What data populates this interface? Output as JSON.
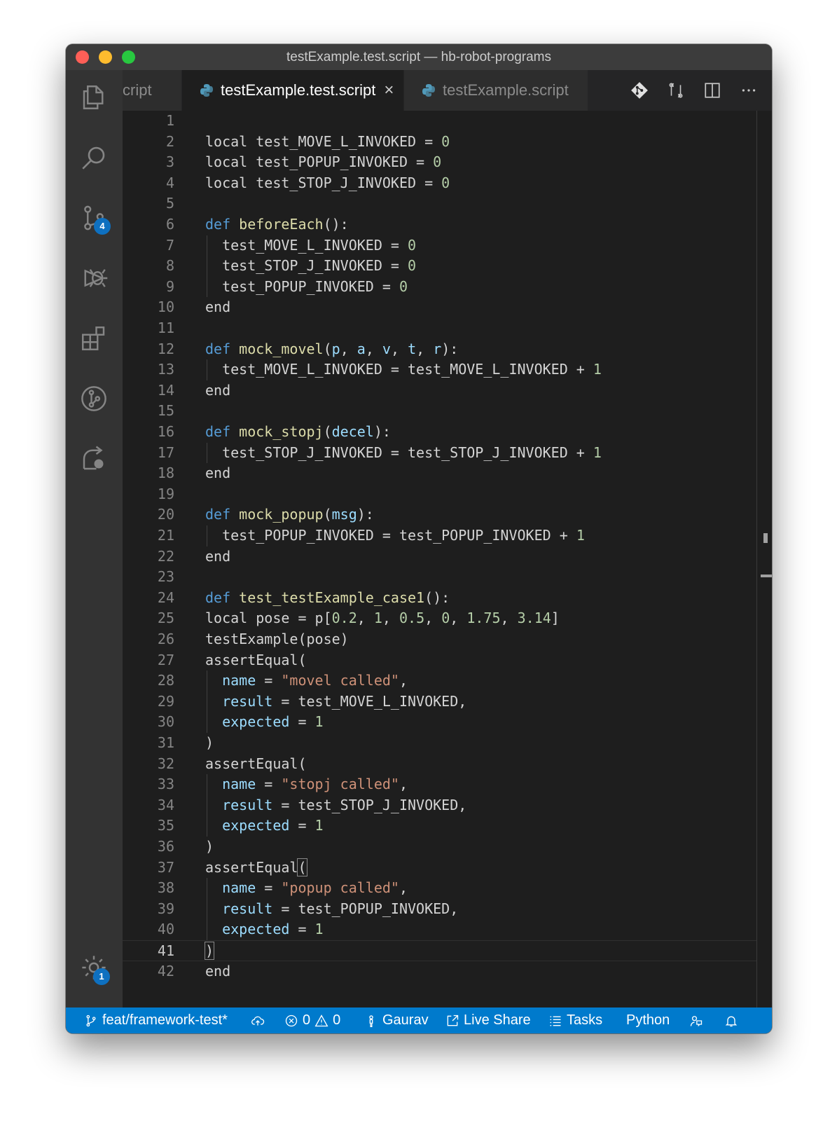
{
  "window": {
    "title": "testExample.test.script — hb-robot-programs"
  },
  "activity_bar": {
    "scm_badge": "4",
    "settings_badge": "1"
  },
  "tabs": [
    {
      "label": "testExample.vars.script",
      "visible_label": "cript",
      "active": false
    },
    {
      "label": "testExample.test.script",
      "active": true,
      "close": "×"
    },
    {
      "label": "testExample.script",
      "active": false
    }
  ],
  "editor": {
    "current_line": 41,
    "lines": [
      {
        "n": "1",
        "indent": 0,
        "tokens": []
      },
      {
        "n": "2",
        "indent": 0,
        "tokens": [
          {
            "t": "local test_MOVE_L_INVOKED = "
          },
          {
            "t": "0",
            "c": "num"
          }
        ]
      },
      {
        "n": "3",
        "indent": 0,
        "tokens": [
          {
            "t": "local test_POPUP_INVOKED = "
          },
          {
            "t": "0",
            "c": "num"
          }
        ]
      },
      {
        "n": "4",
        "indent": 0,
        "tokens": [
          {
            "t": "local test_STOP_J_INVOKED = "
          },
          {
            "t": "0",
            "c": "num"
          }
        ]
      },
      {
        "n": "5",
        "indent": 0,
        "tokens": []
      },
      {
        "n": "6",
        "indent": 0,
        "tokens": [
          {
            "t": "def",
            "c": "kw"
          },
          {
            "t": " "
          },
          {
            "t": "beforeEach",
            "c": "fn"
          },
          {
            "t": "():"
          }
        ]
      },
      {
        "n": "7",
        "indent": 1,
        "tokens": [
          {
            "t": "test_MOVE_L_INVOKED = "
          },
          {
            "t": "0",
            "c": "num"
          }
        ]
      },
      {
        "n": "8",
        "indent": 1,
        "tokens": [
          {
            "t": "test_STOP_J_INVOKED = "
          },
          {
            "t": "0",
            "c": "num"
          }
        ]
      },
      {
        "n": "9",
        "indent": 1,
        "tokens": [
          {
            "t": "test_POPUP_INVOKED = "
          },
          {
            "t": "0",
            "c": "num"
          }
        ]
      },
      {
        "n": "10",
        "indent": 0,
        "tokens": [
          {
            "t": "end"
          }
        ]
      },
      {
        "n": "11",
        "indent": 0,
        "tokens": []
      },
      {
        "n": "12",
        "indent": 0,
        "tokens": [
          {
            "t": "def",
            "c": "kw"
          },
          {
            "t": " "
          },
          {
            "t": "mock_movel",
            "c": "fn"
          },
          {
            "t": "("
          },
          {
            "t": "p",
            "c": "var"
          },
          {
            "t": ", "
          },
          {
            "t": "a",
            "c": "var"
          },
          {
            "t": ", "
          },
          {
            "t": "v",
            "c": "var"
          },
          {
            "t": ", "
          },
          {
            "t": "t",
            "c": "var"
          },
          {
            "t": ", "
          },
          {
            "t": "r",
            "c": "var"
          },
          {
            "t": "):"
          }
        ]
      },
      {
        "n": "13",
        "indent": 1,
        "tokens": [
          {
            "t": "test_MOVE_L_INVOKED = test_MOVE_L_INVOKED + "
          },
          {
            "t": "1",
            "c": "num"
          }
        ]
      },
      {
        "n": "14",
        "indent": 0,
        "tokens": [
          {
            "t": "end"
          }
        ]
      },
      {
        "n": "15",
        "indent": 0,
        "tokens": []
      },
      {
        "n": "16",
        "indent": 0,
        "tokens": [
          {
            "t": "def",
            "c": "kw"
          },
          {
            "t": " "
          },
          {
            "t": "mock_stopj",
            "c": "fn"
          },
          {
            "t": "("
          },
          {
            "t": "decel",
            "c": "var"
          },
          {
            "t": "):"
          }
        ]
      },
      {
        "n": "17",
        "indent": 1,
        "tokens": [
          {
            "t": "test_STOP_J_INVOKED = test_STOP_J_INVOKED + "
          },
          {
            "t": "1",
            "c": "num"
          }
        ]
      },
      {
        "n": "18",
        "indent": 0,
        "tokens": [
          {
            "t": "end"
          }
        ]
      },
      {
        "n": "19",
        "indent": 0,
        "tokens": []
      },
      {
        "n": "20",
        "indent": 0,
        "tokens": [
          {
            "t": "def",
            "c": "kw"
          },
          {
            "t": " "
          },
          {
            "t": "mock_popup",
            "c": "fn"
          },
          {
            "t": "("
          },
          {
            "t": "msg",
            "c": "var"
          },
          {
            "t": "):"
          }
        ]
      },
      {
        "n": "21",
        "indent": 1,
        "tokens": [
          {
            "t": "test_POPUP_INVOKED = test_POPUP_INVOKED + "
          },
          {
            "t": "1",
            "c": "num"
          }
        ]
      },
      {
        "n": "22",
        "indent": 0,
        "tokens": [
          {
            "t": "end"
          }
        ]
      },
      {
        "n": "23",
        "indent": 0,
        "tokens": []
      },
      {
        "n": "24",
        "indent": 0,
        "tokens": [
          {
            "t": "def",
            "c": "kw"
          },
          {
            "t": " "
          },
          {
            "t": "test_testExample_case1",
            "c": "fn"
          },
          {
            "t": "():"
          }
        ]
      },
      {
        "n": "25",
        "indent": 0,
        "tokens": [
          {
            "t": "local pose = p["
          },
          {
            "t": "0.2",
            "c": "num"
          },
          {
            "t": ", "
          },
          {
            "t": "1",
            "c": "num"
          },
          {
            "t": ", "
          },
          {
            "t": "0.5",
            "c": "num"
          },
          {
            "t": ", "
          },
          {
            "t": "0",
            "c": "num"
          },
          {
            "t": ", "
          },
          {
            "t": "1.75",
            "c": "num"
          },
          {
            "t": ", "
          },
          {
            "t": "3.14",
            "c": "num"
          },
          {
            "t": "]"
          }
        ]
      },
      {
        "n": "26",
        "indent": 0,
        "tokens": [
          {
            "t": "testExample(pose)"
          }
        ]
      },
      {
        "n": "27",
        "indent": 0,
        "tokens": [
          {
            "t": "assertEqual("
          }
        ]
      },
      {
        "n": "28",
        "indent": 1,
        "tokens": [
          {
            "t": "name",
            "c": "var"
          },
          {
            "t": " = "
          },
          {
            "t": "\"movel called\"",
            "c": "str"
          },
          {
            "t": ","
          }
        ]
      },
      {
        "n": "29",
        "indent": 1,
        "tokens": [
          {
            "t": "result",
            "c": "var"
          },
          {
            "t": " = test_MOVE_L_INVOKED,"
          }
        ]
      },
      {
        "n": "30",
        "indent": 1,
        "tokens": [
          {
            "t": "expected",
            "c": "var"
          },
          {
            "t": " = "
          },
          {
            "t": "1",
            "c": "num"
          }
        ]
      },
      {
        "n": "31",
        "indent": 0,
        "tokens": [
          {
            "t": ")"
          }
        ]
      },
      {
        "n": "32",
        "indent": 0,
        "tokens": [
          {
            "t": "assertEqual("
          }
        ]
      },
      {
        "n": "33",
        "indent": 1,
        "tokens": [
          {
            "t": "name",
            "c": "var"
          },
          {
            "t": " = "
          },
          {
            "t": "\"stopj called\"",
            "c": "str"
          },
          {
            "t": ","
          }
        ]
      },
      {
        "n": "34",
        "indent": 1,
        "tokens": [
          {
            "t": "result",
            "c": "var"
          },
          {
            "t": " = test_STOP_J_INVOKED,"
          }
        ]
      },
      {
        "n": "35",
        "indent": 1,
        "tokens": [
          {
            "t": "expected",
            "c": "var"
          },
          {
            "t": " = "
          },
          {
            "t": "1",
            "c": "num"
          }
        ]
      },
      {
        "n": "36",
        "indent": 0,
        "tokens": [
          {
            "t": ")"
          }
        ]
      },
      {
        "n": "37",
        "indent": 0,
        "tokens": [
          {
            "t": "assertEqual"
          },
          {
            "t": "(",
            "c": "bm"
          }
        ]
      },
      {
        "n": "38",
        "indent": 1,
        "tokens": [
          {
            "t": "name",
            "c": "var"
          },
          {
            "t": " = "
          },
          {
            "t": "\"popup called\"",
            "c": "str"
          },
          {
            "t": ","
          }
        ]
      },
      {
        "n": "39",
        "indent": 1,
        "tokens": [
          {
            "t": "result",
            "c": "var"
          },
          {
            "t": " = test_POPUP_INVOKED,"
          }
        ]
      },
      {
        "n": "40",
        "indent": 1,
        "tokens": [
          {
            "t": "expected",
            "c": "var"
          },
          {
            "t": " = "
          },
          {
            "t": "1",
            "c": "num"
          }
        ]
      },
      {
        "n": "41",
        "indent": 0,
        "tokens": [
          {
            "t": ")",
            "c": "bm"
          }
        ]
      },
      {
        "n": "42",
        "indent": 0,
        "tokens": [
          {
            "t": "end"
          }
        ]
      }
    ]
  },
  "status_bar": {
    "branch": "feat/framework-test*",
    "errors": "0",
    "warnings": "0",
    "user": "Gaurav",
    "live_share": "Live Share",
    "tasks": "Tasks",
    "language": "Python"
  },
  "colors": {
    "keyword": "#569cd6",
    "function": "#dcdcaa",
    "number": "#b5cea8",
    "string": "#ce9178",
    "variable": "#9cdcfe",
    "status_bar": "#007acc"
  }
}
